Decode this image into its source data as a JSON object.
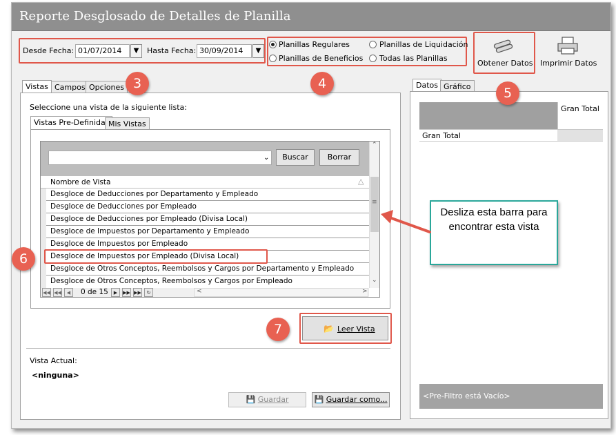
{
  "window": {
    "title": "Reporte Desglosado de Detalles de Planilla"
  },
  "dates": {
    "from_label": "Desde Fecha:",
    "from_value": "01/07/2014",
    "to_label": "Hasta Fecha:",
    "to_value": "30/09/2014"
  },
  "payroll_options": [
    {
      "label": "Planillas Regulares",
      "selected": true
    },
    {
      "label": "Planillas de Liquidación",
      "selected": false
    },
    {
      "label": "Planillas de Beneficios",
      "selected": false
    },
    {
      "label": "Todas las Planillas",
      "selected": false
    }
  ],
  "toolbar": {
    "get_data": "Obtener Datos",
    "print_data": "Imprimir Datos"
  },
  "left_tabs": [
    "Vistas",
    "Campos",
    "Opciones"
  ],
  "views": {
    "instruction": "Seleccione una vista de la siguiente lista:",
    "subtabs": [
      "Vistas Pre-Definidas",
      "Mis Vistas"
    ],
    "search_button": "Buscar",
    "clear_button": "Borrar",
    "column_header": "Nombre de Vista",
    "rows": [
      "Desgloce de Deducciones por Departamento y Empleado",
      "Desgloce de Deducciones por Empleado",
      "Desgloce de Deducciones por Empleado (Divisa Local)",
      "Desgloce de Impuestos por Departamento y Empleado",
      "Desgloce de Impuestos por Empleado",
      "Desgloce de Impuestos por Empleado (Divisa Local)",
      "Desgloce de Otros Conceptos, Reembolsos y Cargos por Departamento y Empleado",
      "Desgloce de Otros Conceptos, Reembolsos y Cargos por Empleado"
    ],
    "pager": "0 de 15",
    "read_view": "Leer Vista",
    "current_label": "Vista Actual:",
    "current_value": "<ninguna>",
    "save": "Guardar",
    "save_as": "Guardar como..."
  },
  "right_tabs": [
    "Datos",
    "Gráfico"
  ],
  "grid": {
    "col_header": "Gran Total",
    "row_header": "Gran Total",
    "footer": "<Pre-Filtro está Vacío>"
  },
  "callout": {
    "text": "Desliza esta barra para encontrar esta vista"
  },
  "markers": [
    "3",
    "4",
    "5",
    "6",
    "7"
  ],
  "colors": {
    "highlight": "#e0574a",
    "marker": "#e86152",
    "callout_border": "#2aa79a",
    "titlebar": "#8f8f8f"
  }
}
